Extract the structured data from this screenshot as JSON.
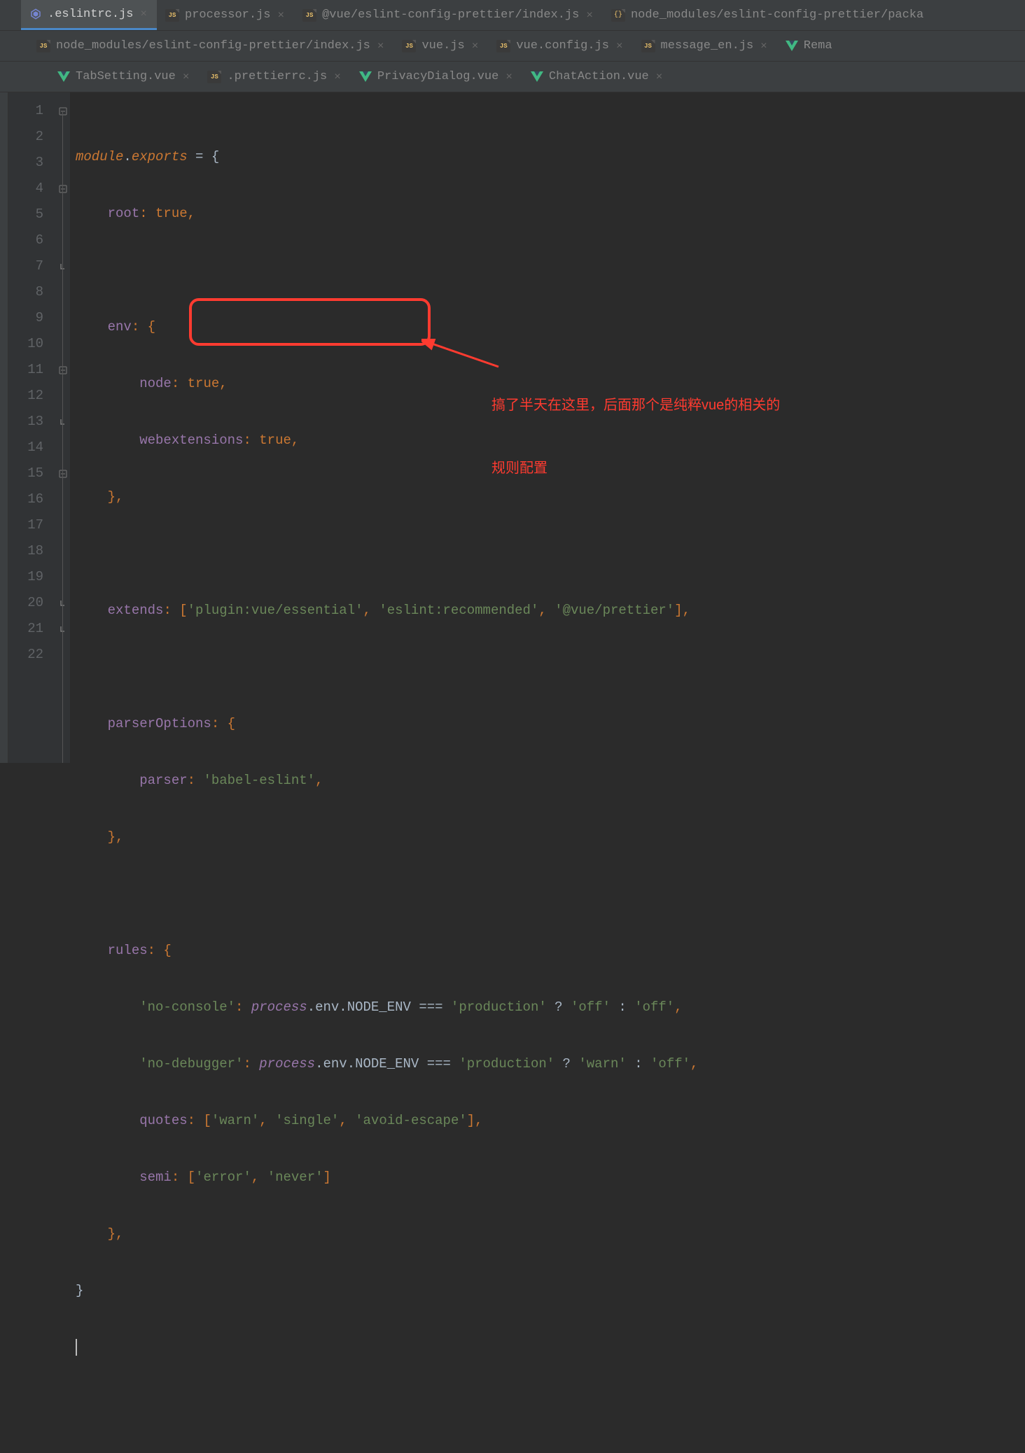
{
  "tabs": {
    "row1": [
      {
        "label": ".eslintrc.js",
        "icon": "eslint",
        "active": true
      },
      {
        "label": "processor.js",
        "icon": "js"
      },
      {
        "label": "@vue/eslint-config-prettier/index.js",
        "icon": "js"
      },
      {
        "label": "node_modules/eslint-config-prettier/packa",
        "icon": "json",
        "no_close": true
      }
    ],
    "row2": [
      {
        "label": "node_modules/eslint-config-prettier/index.js",
        "icon": "js"
      },
      {
        "label": "vue.js",
        "icon": "js"
      },
      {
        "label": "vue.config.js",
        "icon": "js"
      },
      {
        "label": "message_en.js",
        "icon": "js"
      },
      {
        "label": "Rema",
        "icon": "vue",
        "no_close": true
      }
    ],
    "row3": [
      {
        "label": "TabSetting.vue",
        "icon": "vue"
      },
      {
        "label": ".prettierrc.js",
        "icon": "js"
      },
      {
        "label": "PrivacyDialog.vue",
        "icon": "vue"
      },
      {
        "label": "ChatAction.vue",
        "icon": "vue"
      }
    ]
  },
  "line_numbers": [
    "1",
    "2",
    "3",
    "4",
    "5",
    "6",
    "7",
    "8",
    "9",
    "10",
    "11",
    "12",
    "13",
    "14",
    "15",
    "16",
    "17",
    "18",
    "19",
    "20",
    "21",
    "22"
  ],
  "code": {
    "l1": {
      "a": "module",
      "b": ".",
      "c": "exports",
      "d": " = {"
    },
    "l2": {
      "a": "root",
      "b": ": ",
      "c": "true",
      "d": ","
    },
    "l4": {
      "a": "env",
      "b": ": {"
    },
    "l5": {
      "a": "node",
      "b": ": ",
      "c": "true",
      "d": ","
    },
    "l6": {
      "a": "webextensions",
      "b": ": ",
      "c": "true",
      "d": ","
    },
    "l7": {
      "a": "},"
    },
    "l9": {
      "a": "extends",
      "b": ": [",
      "c": "'plugin:vue/essential'",
      "d": ", ",
      "e": "'eslint:recommended'",
      "f": ", ",
      "g": "'@vue/prettier'",
      "h": "],"
    },
    "l11": {
      "a": "parserOptions",
      "b": ": {"
    },
    "l12": {
      "a": "parser",
      "b": ": ",
      "c": "'babel-eslint'",
      "d": ","
    },
    "l13": {
      "a": "},"
    },
    "l15": {
      "a": "rules",
      "b": ": {"
    },
    "l16": {
      "a": "'no-console'",
      "b": ": ",
      "c": "process",
      "d": ".env.NODE_ENV === ",
      "e": "'production'",
      "f": " ? ",
      "g": "'off'",
      "h": " : ",
      "i": "'off'",
      "j": ","
    },
    "l17": {
      "a": "'no-debugger'",
      "b": ": ",
      "c": "process",
      "d": ".env.NODE_ENV === ",
      "e": "'production'",
      "f": " ? ",
      "g": "'warn'",
      "h": " : ",
      "i": "'off'",
      "j": ","
    },
    "l18": {
      "a": "quotes",
      "b": ": [",
      "c": "'warn'",
      "d": ", ",
      "e": "'single'",
      "f": ", ",
      "g": "'avoid-escape'",
      "h": "],"
    },
    "l19": {
      "a": "semi",
      "b": ": [",
      "c": "'error'",
      "d": ", ",
      "e": "'never'",
      "f": "]"
    },
    "l20": {
      "a": "},"
    },
    "l21": {
      "a": "}"
    }
  },
  "annotation": {
    "line1": "搞了半天在这里，后面那个是纯粹vue的相关的",
    "line2": "规则配置"
  }
}
